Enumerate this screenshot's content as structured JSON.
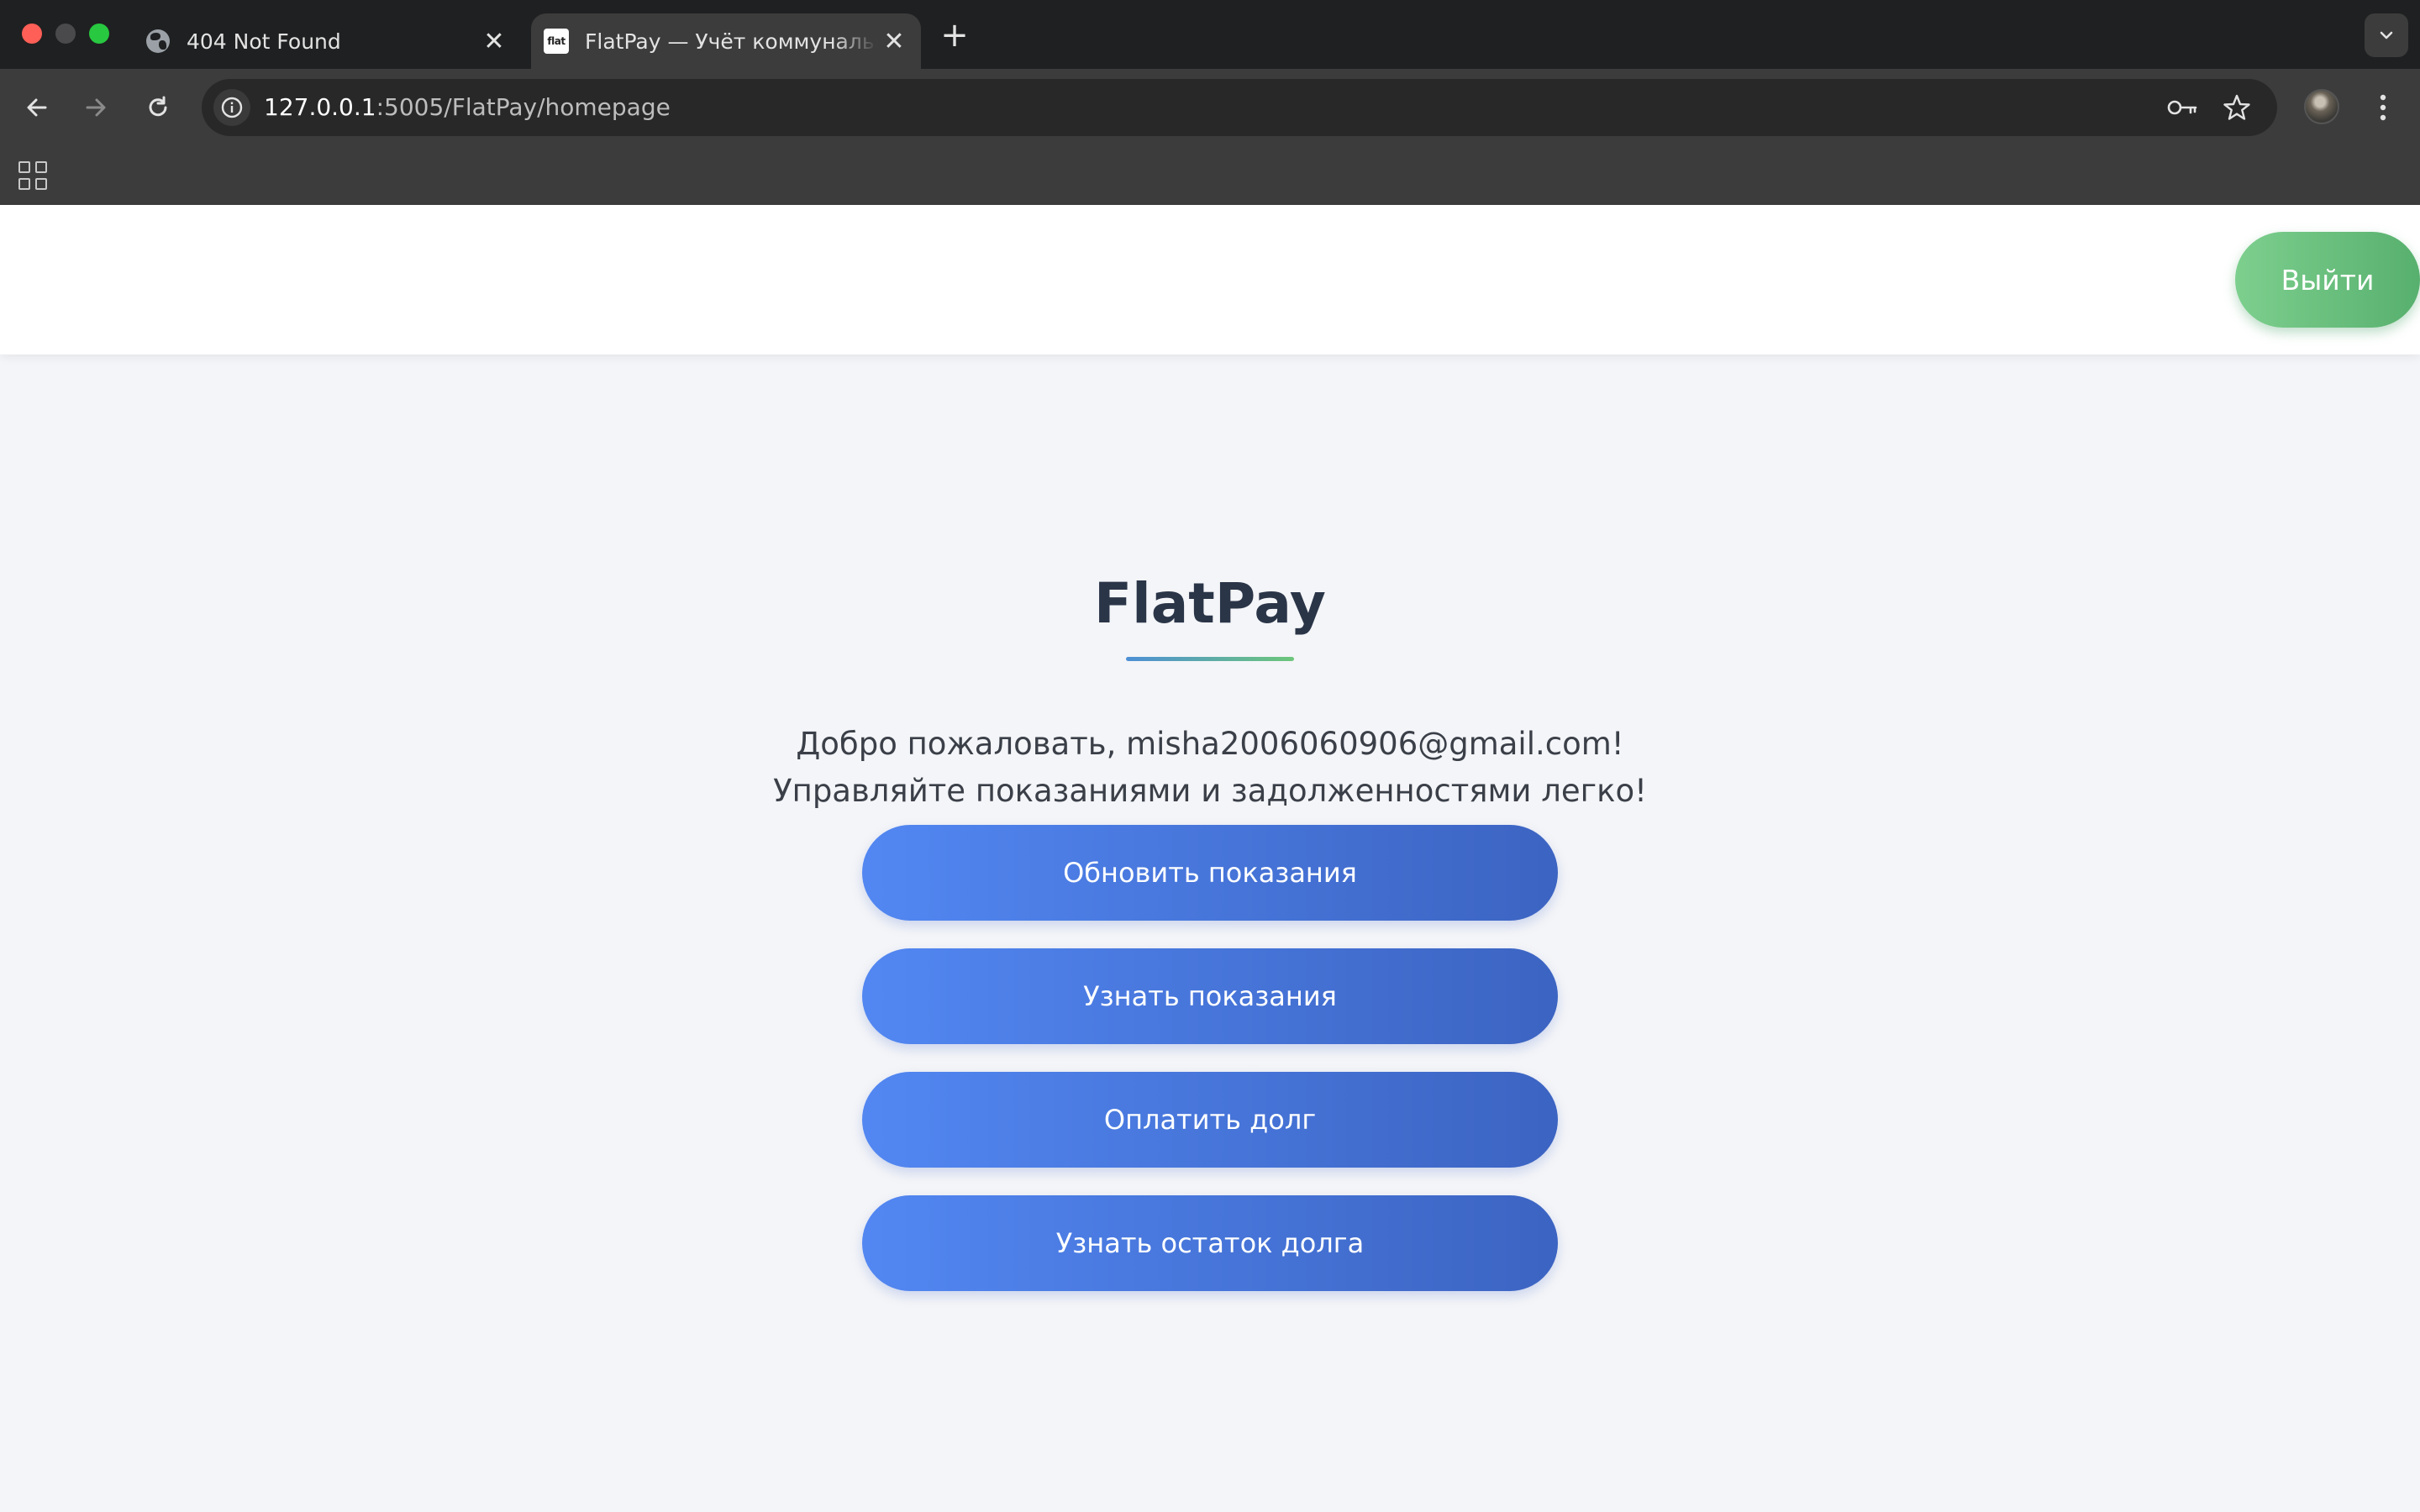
{
  "browser": {
    "tabs": [
      {
        "title": "404 Not Found",
        "icon": "globe-icon",
        "active": false
      },
      {
        "title": "FlatPay — Учёт коммунальных",
        "icon": "flat",
        "active": true
      }
    ],
    "favicon_text": "flat",
    "close_glyph": "✕",
    "new_tab_glyph": "+",
    "url_host": "127.0.0.1",
    "url_path": ":5005/FlatPay/homepage"
  },
  "header": {
    "logout_label": "Выйти"
  },
  "main": {
    "brand": "FlatPay",
    "welcome_line1": "Добро пожаловать, misha2006060906@gmail.com!",
    "welcome_line2": "Управляйте показаниями и задолженностями легко!",
    "actions": [
      {
        "label": "Обновить показания"
      },
      {
        "label": "Узнать показания"
      },
      {
        "label": "Оплатить долг"
      },
      {
        "label": "Узнать остаток долга"
      }
    ]
  },
  "colors": {
    "accent_blue": "#4a7ae8",
    "accent_green": "#6cc47f",
    "brand_text": "#2a3548"
  }
}
